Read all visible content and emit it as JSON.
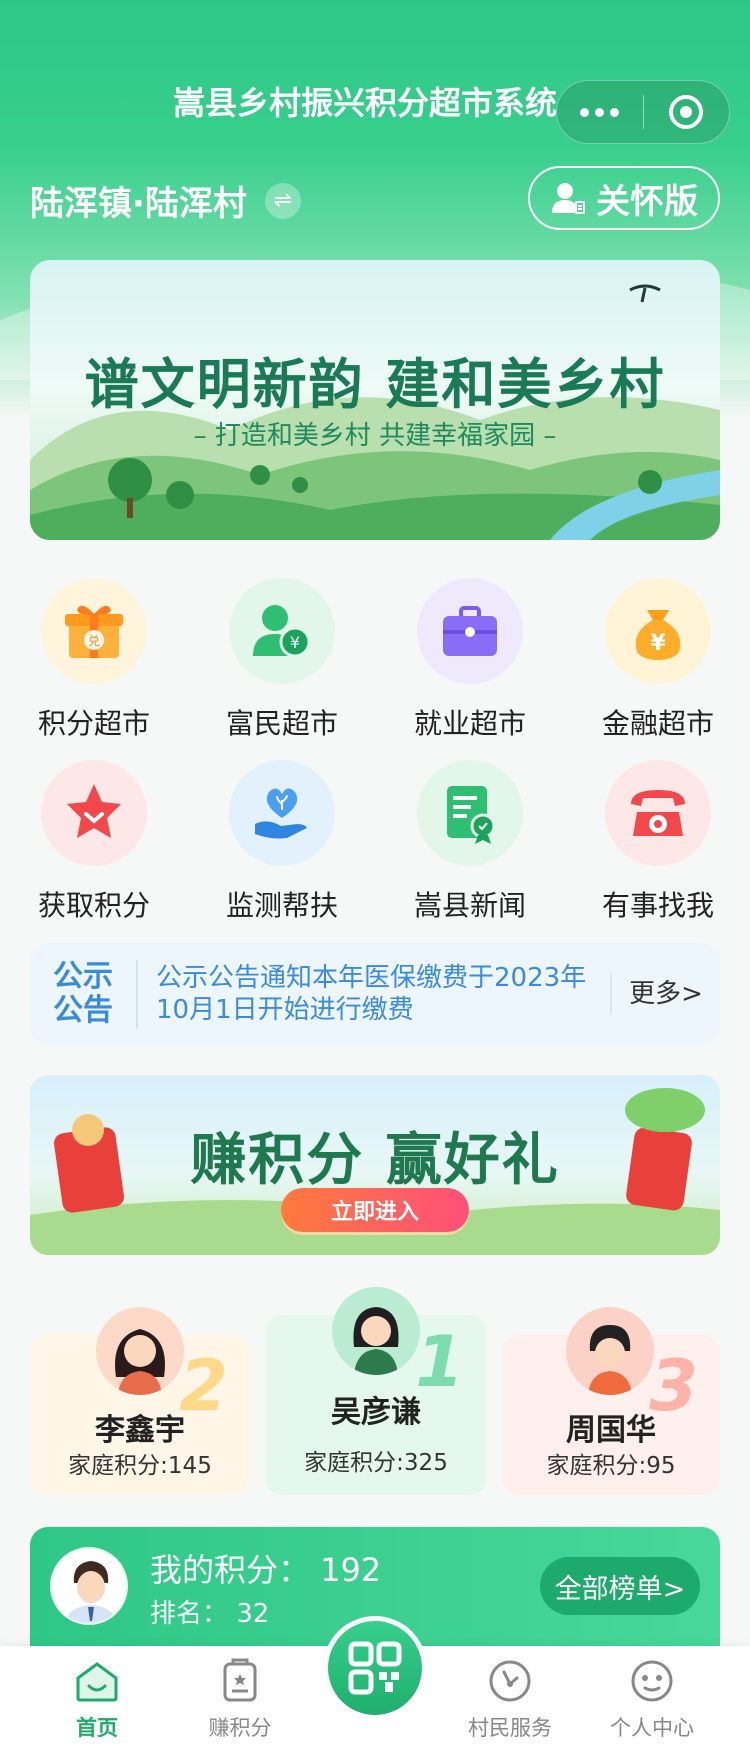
{
  "header": {
    "title": "嵩县乡村振兴积分超市系统",
    "location": "陆浑镇·陆浑村",
    "care_mode_label": "关怀版"
  },
  "banner": {
    "title": "谱文明新韵 建和美乡村",
    "subtitle": "– 打造和美乡村  共建幸福家园 –"
  },
  "grid": [
    {
      "label": "积分超市",
      "icon": "gift-icon"
    },
    {
      "label": "富民超市",
      "icon": "person-money-icon"
    },
    {
      "label": "就业超市",
      "icon": "briefcase-icon"
    },
    {
      "label": "金融超市",
      "icon": "money-bag-icon"
    },
    {
      "label": "获取积分",
      "icon": "star-badge-icon"
    },
    {
      "label": "监测帮扶",
      "icon": "heart-hand-icon"
    },
    {
      "label": "嵩县新闻",
      "icon": "news-icon"
    },
    {
      "label": "有事找我",
      "icon": "telephone-icon"
    }
  ],
  "notice": {
    "tag": "公示公告",
    "text": "公示公告通知本年医保缴费于2023年10月1日开始进行缴费",
    "more": "更多>"
  },
  "promo": {
    "title": "赚积分 赢好礼",
    "button": "立即进入"
  },
  "ranking": [
    {
      "rank": "1",
      "name": "吴彦谦",
      "score": "家庭积分:325"
    },
    {
      "rank": "2",
      "name": "李鑫宇",
      "score": "家庭积分:145"
    },
    {
      "rank": "3",
      "name": "周国华",
      "score": "家庭积分:95"
    }
  ],
  "mine": {
    "points": "我的积分： 192",
    "rank": "排名： 32",
    "all_button": "全部榜单>"
  },
  "tabbar": [
    {
      "label": "首页",
      "icon": "home-icon",
      "active": true
    },
    {
      "label": "赚积分",
      "icon": "task-icon",
      "active": false
    },
    {
      "label": "村民服务",
      "icon": "service-icon",
      "active": false
    },
    {
      "label": "个人中心",
      "icon": "profile-icon",
      "active": false
    }
  ],
  "colors": {
    "primary": "#2fc786",
    "notice_blue": "#3a8be0"
  }
}
